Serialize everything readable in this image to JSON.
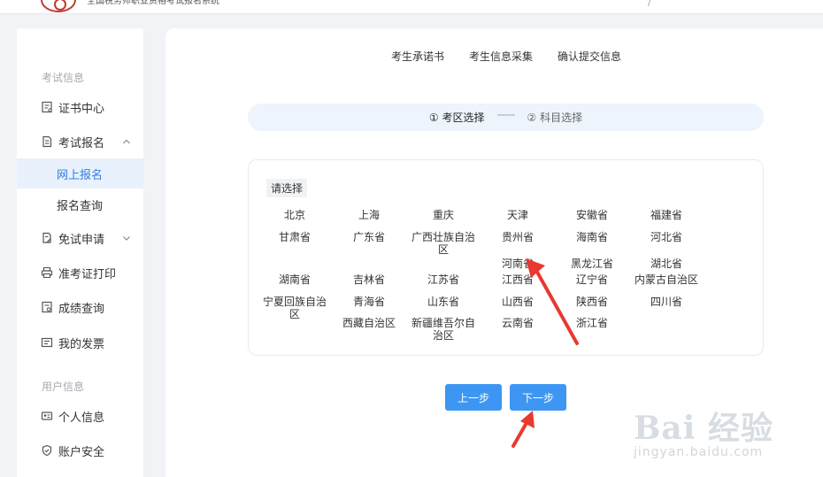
{
  "header": {
    "system_title": "全国税务师职业资格考试报名系统",
    "right_mark": "/"
  },
  "sidebar": {
    "group_exam": "考试信息",
    "group_user": "用户信息",
    "items": [
      {
        "label": "证书中心",
        "icon": "certificate-icon"
      },
      {
        "label": "考试报名",
        "icon": "document-icon",
        "expanded": true
      },
      {
        "label": "网上报名",
        "active": true
      },
      {
        "label": "报名查询"
      },
      {
        "label": "免试申请",
        "icon": "document-edit-icon",
        "expanded": false
      },
      {
        "label": "准考证打印",
        "icon": "printer-icon"
      },
      {
        "label": "成绩查询",
        "icon": "score-icon"
      },
      {
        "label": "我的发票",
        "icon": "invoice-icon"
      },
      {
        "label": "个人信息",
        "icon": "id-card-icon"
      },
      {
        "label": "账户安全",
        "icon": "shield-icon"
      }
    ]
  },
  "tabs": [
    "考生承诺书",
    "考生信息采集",
    "确认提交信息"
  ],
  "steps": [
    {
      "label": "① 考区选择",
      "active": true
    },
    {
      "label": "② 科目选择",
      "active": false
    }
  ],
  "region": {
    "prompt": "请选择",
    "provinces": [
      "北京",
      "上海",
      "重庆",
      "天津",
      "安徽省",
      "福建省",
      "甘肃省",
      "广东省",
      "广西壮族自治区",
      "贵州省",
      "海南省",
      "河北省",
      "河南省",
      "黑龙江省",
      "湖北省",
      "湖南省",
      "吉林省",
      "江苏省",
      "江西省",
      "辽宁省",
      "内蒙古自治区",
      "宁夏回族自治区",
      "青海省",
      "山东省",
      "山西省",
      "陕西省",
      "四川省",
      "西藏自治区",
      "新疆维吾尔自治区",
      "云南省",
      "浙江省"
    ]
  },
  "buttons": {
    "prev": "上一步",
    "next": "下一步"
  },
  "annotation_color": "#e8392f",
  "accent_color": "#3d97f2",
  "watermark": {
    "main": "Bai 经验",
    "sub": "jingyan.baidu.com"
  }
}
